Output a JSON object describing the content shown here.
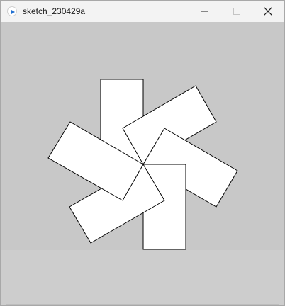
{
  "window": {
    "title": "sketch_230429a",
    "app_icon": "processing-play-icon",
    "controls": {
      "minimize_icon": "minimize-icon",
      "maximize_icon": "maximize-icon",
      "close_icon": "close-icon"
    }
  },
  "sketch": {
    "background_color": "#c8c8c8",
    "shape_fill": "#ffffff",
    "shape_stroke": "#000000",
    "shape_count": 6
  }
}
